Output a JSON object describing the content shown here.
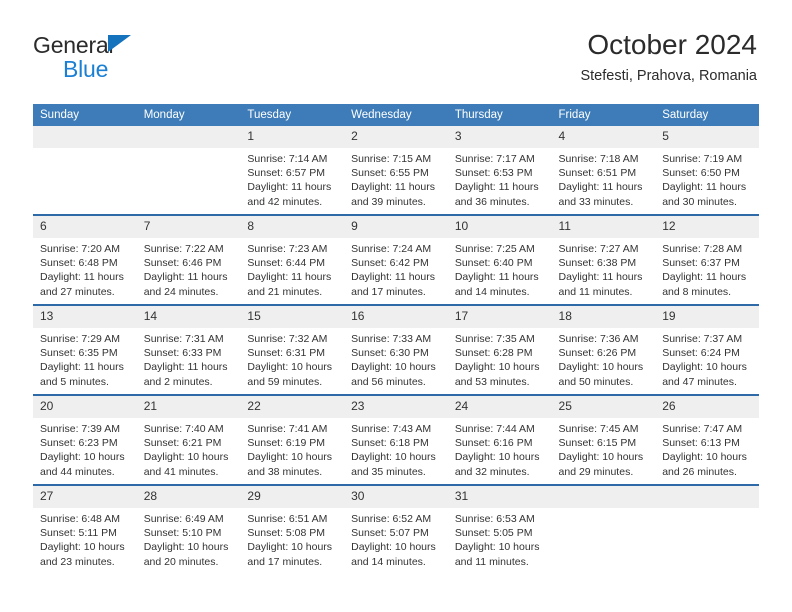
{
  "logo": {
    "word_top": "General",
    "word_bottom": "Blue",
    "triangle_color": "#1572bd",
    "blue_color": "#1b7fd4"
  },
  "header": {
    "title": "October 2024",
    "subtitle": "Stefesti, Prahova, Romania",
    "header_bg": "#3d7cb8",
    "row_divider": "#2f6aa8",
    "daynum_bg": "#efefef"
  },
  "weekdays": [
    "Sunday",
    "Monday",
    "Tuesday",
    "Wednesday",
    "Thursday",
    "Friday",
    "Saturday"
  ],
  "labels": {
    "sunrise": "Sunrise:",
    "sunset": "Sunset:",
    "daylight": "Daylight:"
  },
  "weeks": [
    [
      {
        "day": "",
        "empty": true
      },
      {
        "day": "",
        "empty": true
      },
      {
        "day": "1",
        "sunrise": "Sunrise: 7:14 AM",
        "sunset": "Sunset: 6:57 PM",
        "daylight": "Daylight: 11 hours and 42 minutes."
      },
      {
        "day": "2",
        "sunrise": "Sunrise: 7:15 AM",
        "sunset": "Sunset: 6:55 PM",
        "daylight": "Daylight: 11 hours and 39 minutes."
      },
      {
        "day": "3",
        "sunrise": "Sunrise: 7:17 AM",
        "sunset": "Sunset: 6:53 PM",
        "daylight": "Daylight: 11 hours and 36 minutes."
      },
      {
        "day": "4",
        "sunrise": "Sunrise: 7:18 AM",
        "sunset": "Sunset: 6:51 PM",
        "daylight": "Daylight: 11 hours and 33 minutes."
      },
      {
        "day": "5",
        "sunrise": "Sunrise: 7:19 AM",
        "sunset": "Sunset: 6:50 PM",
        "daylight": "Daylight: 11 hours and 30 minutes."
      }
    ],
    [
      {
        "day": "6",
        "sunrise": "Sunrise: 7:20 AM",
        "sunset": "Sunset: 6:48 PM",
        "daylight": "Daylight: 11 hours and 27 minutes."
      },
      {
        "day": "7",
        "sunrise": "Sunrise: 7:22 AM",
        "sunset": "Sunset: 6:46 PM",
        "daylight": "Daylight: 11 hours and 24 minutes."
      },
      {
        "day": "8",
        "sunrise": "Sunrise: 7:23 AM",
        "sunset": "Sunset: 6:44 PM",
        "daylight": "Daylight: 11 hours and 21 minutes."
      },
      {
        "day": "9",
        "sunrise": "Sunrise: 7:24 AM",
        "sunset": "Sunset: 6:42 PM",
        "daylight": "Daylight: 11 hours and 17 minutes."
      },
      {
        "day": "10",
        "sunrise": "Sunrise: 7:25 AM",
        "sunset": "Sunset: 6:40 PM",
        "daylight": "Daylight: 11 hours and 14 minutes."
      },
      {
        "day": "11",
        "sunrise": "Sunrise: 7:27 AM",
        "sunset": "Sunset: 6:38 PM",
        "daylight": "Daylight: 11 hours and 11 minutes."
      },
      {
        "day": "12",
        "sunrise": "Sunrise: 7:28 AM",
        "sunset": "Sunset: 6:37 PM",
        "daylight": "Daylight: 11 hours and 8 minutes."
      }
    ],
    [
      {
        "day": "13",
        "sunrise": "Sunrise: 7:29 AM",
        "sunset": "Sunset: 6:35 PM",
        "daylight": "Daylight: 11 hours and 5 minutes."
      },
      {
        "day": "14",
        "sunrise": "Sunrise: 7:31 AM",
        "sunset": "Sunset: 6:33 PM",
        "daylight": "Daylight: 11 hours and 2 minutes."
      },
      {
        "day": "15",
        "sunrise": "Sunrise: 7:32 AM",
        "sunset": "Sunset: 6:31 PM",
        "daylight": "Daylight: 10 hours and 59 minutes."
      },
      {
        "day": "16",
        "sunrise": "Sunrise: 7:33 AM",
        "sunset": "Sunset: 6:30 PM",
        "daylight": "Daylight: 10 hours and 56 minutes."
      },
      {
        "day": "17",
        "sunrise": "Sunrise: 7:35 AM",
        "sunset": "Sunset: 6:28 PM",
        "daylight": "Daylight: 10 hours and 53 minutes."
      },
      {
        "day": "18",
        "sunrise": "Sunrise: 7:36 AM",
        "sunset": "Sunset: 6:26 PM",
        "daylight": "Daylight: 10 hours and 50 minutes."
      },
      {
        "day": "19",
        "sunrise": "Sunrise: 7:37 AM",
        "sunset": "Sunset: 6:24 PM",
        "daylight": "Daylight: 10 hours and 47 minutes."
      }
    ],
    [
      {
        "day": "20",
        "sunrise": "Sunrise: 7:39 AM",
        "sunset": "Sunset: 6:23 PM",
        "daylight": "Daylight: 10 hours and 44 minutes."
      },
      {
        "day": "21",
        "sunrise": "Sunrise: 7:40 AM",
        "sunset": "Sunset: 6:21 PM",
        "daylight": "Daylight: 10 hours and 41 minutes."
      },
      {
        "day": "22",
        "sunrise": "Sunrise: 7:41 AM",
        "sunset": "Sunset: 6:19 PM",
        "daylight": "Daylight: 10 hours and 38 minutes."
      },
      {
        "day": "23",
        "sunrise": "Sunrise: 7:43 AM",
        "sunset": "Sunset: 6:18 PM",
        "daylight": "Daylight: 10 hours and 35 minutes."
      },
      {
        "day": "24",
        "sunrise": "Sunrise: 7:44 AM",
        "sunset": "Sunset: 6:16 PM",
        "daylight": "Daylight: 10 hours and 32 minutes."
      },
      {
        "day": "25",
        "sunrise": "Sunrise: 7:45 AM",
        "sunset": "Sunset: 6:15 PM",
        "daylight": "Daylight: 10 hours and 29 minutes."
      },
      {
        "day": "26",
        "sunrise": "Sunrise: 7:47 AM",
        "sunset": "Sunset: 6:13 PM",
        "daylight": "Daylight: 10 hours and 26 minutes."
      }
    ],
    [
      {
        "day": "27",
        "sunrise": "Sunrise: 6:48 AM",
        "sunset": "Sunset: 5:11 PM",
        "daylight": "Daylight: 10 hours and 23 minutes."
      },
      {
        "day": "28",
        "sunrise": "Sunrise: 6:49 AM",
        "sunset": "Sunset: 5:10 PM",
        "daylight": "Daylight: 10 hours and 20 minutes."
      },
      {
        "day": "29",
        "sunrise": "Sunrise: 6:51 AM",
        "sunset": "Sunset: 5:08 PM",
        "daylight": "Daylight: 10 hours and 17 minutes."
      },
      {
        "day": "30",
        "sunrise": "Sunrise: 6:52 AM",
        "sunset": "Sunset: 5:07 PM",
        "daylight": "Daylight: 10 hours and 14 minutes."
      },
      {
        "day": "31",
        "sunrise": "Sunrise: 6:53 AM",
        "sunset": "Sunset: 5:05 PM",
        "daylight": "Daylight: 10 hours and 11 minutes."
      },
      {
        "day": "",
        "empty": true
      },
      {
        "day": "",
        "empty": true
      }
    ]
  ]
}
